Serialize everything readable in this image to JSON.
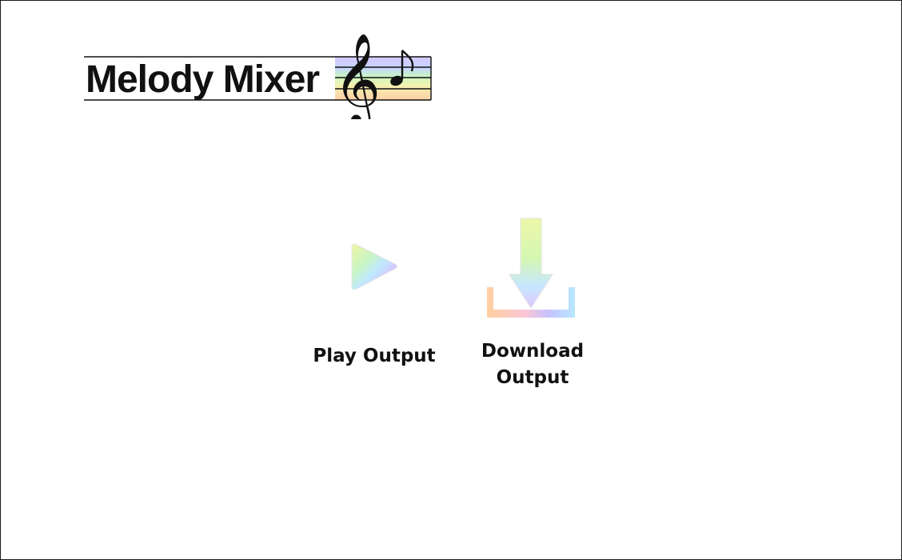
{
  "app": {
    "title": "Melody Mixer"
  },
  "actions": {
    "play": {
      "label": "Play Output",
      "icon": "play-icon"
    },
    "download": {
      "label_line1": "Download",
      "label_line2": "Output",
      "icon": "download-icon"
    }
  },
  "colors": {
    "rainbow": [
      "#f9b9e0",
      "#c6c2ff",
      "#b6e9ff",
      "#bff7b8",
      "#f4f6a8",
      "#ffcf9f"
    ],
    "text": "#111111",
    "border": "#1a1a1a",
    "background": "#ffffff"
  }
}
